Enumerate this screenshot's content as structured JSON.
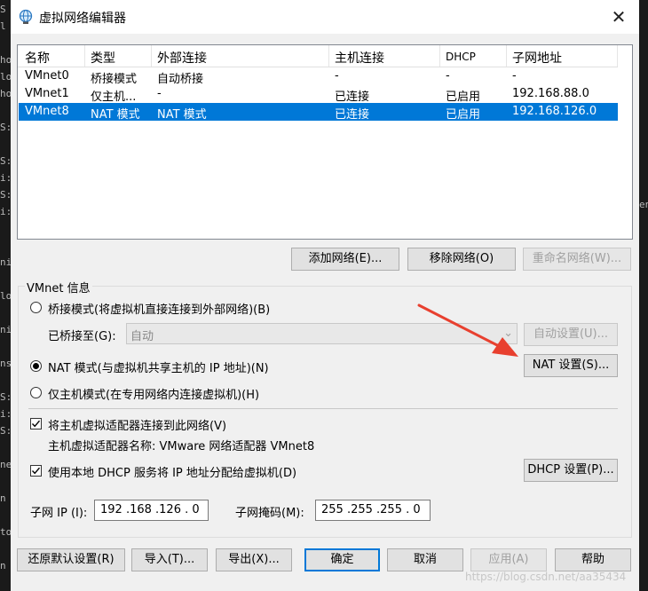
{
  "background": {
    "left_chars": [
      "S",
      "l",
      "",
      "ho",
      "lo",
      "ho",
      "",
      "S:",
      "",
      "S:",
      "i:",
      "S:",
      "i:",
      "",
      "",
      "ni",
      "",
      "lo",
      "",
      "ni",
      "",
      "ns",
      "",
      "S:",
      "i:",
      "S:",
      "",
      "ne",
      "",
      "n",
      "",
      "to",
      "",
      "n"
    ],
    "right_text": "en"
  },
  "window": {
    "title": "虚拟网络编辑器",
    "close_glyph": "✕"
  },
  "netlist": {
    "headers": [
      "名称",
      "类型",
      "外部连接",
      "主机连接",
      "DHCP",
      "子网地址"
    ],
    "rows": [
      {
        "name": "VMnet0",
        "type": "桥接模式",
        "external": "自动桥接",
        "host": "-",
        "dhcp": "-",
        "subnet": "-",
        "selected": false
      },
      {
        "name": "VMnet1",
        "type": "仅主机...",
        "external": "-",
        "host": "已连接",
        "dhcp": "已启用",
        "subnet": "192.168.88.0",
        "selected": false
      },
      {
        "name": "VMnet8",
        "type": "NAT 模式",
        "external": "NAT 模式",
        "host": "已连接",
        "dhcp": "已启用",
        "subnet": "192.168.126.0",
        "selected": true
      }
    ]
  },
  "list_buttons": {
    "add": "添加网络(E)...",
    "remove": "移除网络(O)",
    "rename": "重命名网络(W)..."
  },
  "vmnet_info": {
    "label": "VMnet 信息",
    "bridged_radio": "桥接模式(将虚拟机直接连接到外部网络)(B)",
    "bridged_to_label": "已桥接至(G):",
    "bridged_to_value": "自动",
    "auto_settings": "自动设置(U)...",
    "nat_radio": "NAT 模式(与虚拟机共享主机的 IP 地址)(N)",
    "nat_settings": "NAT 设置(S)...",
    "hostonly_radio": "仅主机模式(在专用网络内连接虚拟机)(H)",
    "connect_adapter": "将主机虚拟适配器连接到此网络(V)",
    "adapter_name": "主机虚拟适配器名称: VMware 网络适配器 VMnet8",
    "use_dhcp": "使用本地 DHCP 服务将 IP 地址分配给虚拟机(D)",
    "dhcp_settings": "DHCP 设置(P)...",
    "subnet_ip_label": "子网 IP (I):",
    "subnet_ip": "192 .168 .126 .  0",
    "subnet_mask_label": "子网掩码(M):",
    "subnet_mask": "255 .255 .255 .  0",
    "selected_mode": "nat"
  },
  "footer": {
    "restore": "还原默认设置(R)",
    "import": "导入(T)...",
    "export": "导出(X)...",
    "ok": "确定",
    "cancel": "取消",
    "apply": "应用(A)",
    "help": "帮助"
  },
  "watermark": "https://blog.csdn.net/aa35434",
  "colors": {
    "selection": "#0078d7",
    "arrow": "#e8402f",
    "default_button_border": "#0078d7"
  }
}
